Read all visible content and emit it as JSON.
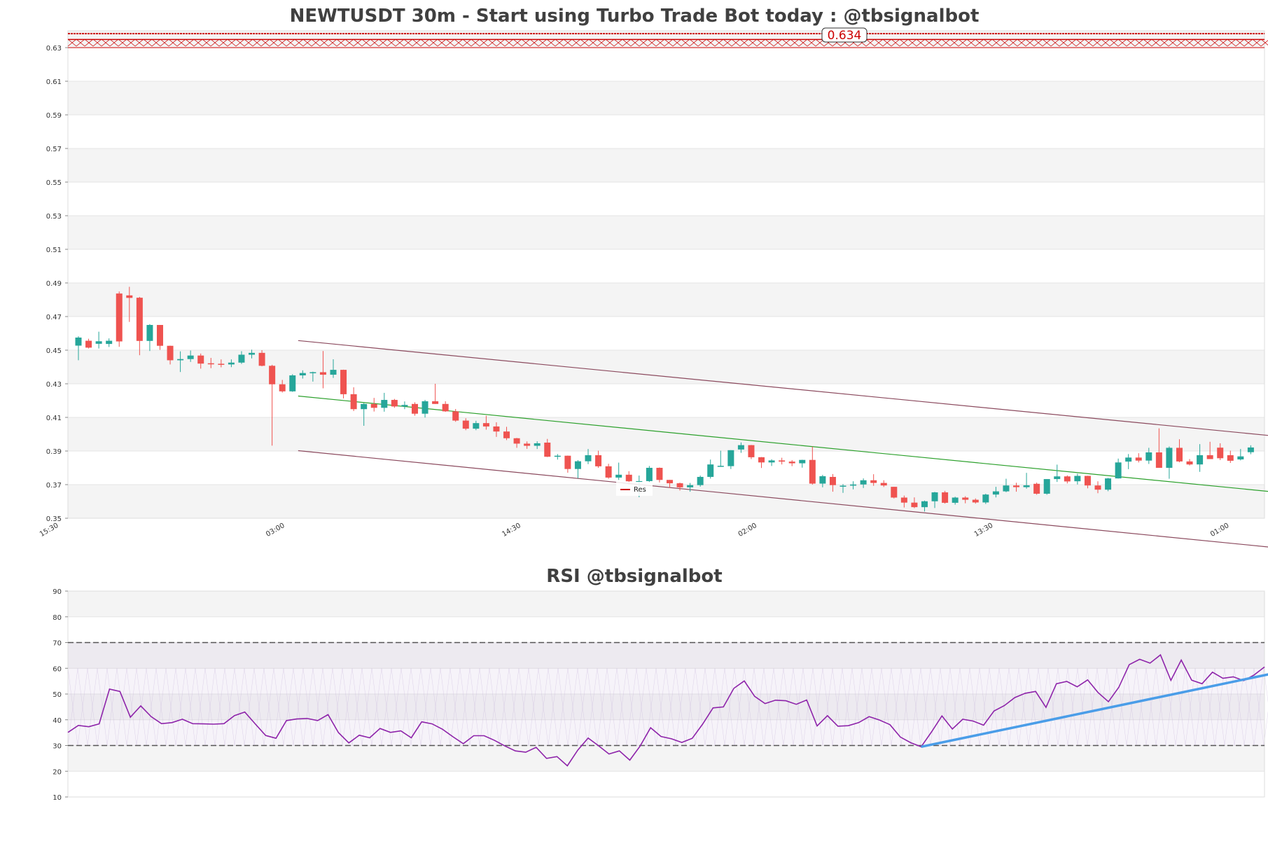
{
  "chart_data": [
    {
      "type": "candlestick",
      "title": "NEWTUSDT 30m - Start using Turbo Trade Bot today : @tbsignalbot",
      "ylim": [
        0.35,
        0.64
      ],
      "y_ticks": [
        "0.35",
        "0.37",
        "0.39",
        "0.41",
        "0.43",
        "0.45",
        "0.47",
        "0.49",
        "0.51",
        "0.53",
        "0.55",
        "0.57",
        "0.59",
        "0.61",
        "0.63"
      ],
      "x_ticks": [
        "15:30",
        "03:00",
        "14:30",
        "02:00",
        "13:30",
        "01:00"
      ],
      "grid": true,
      "colors": {
        "up": "#26a69a",
        "down": "#ef5350",
        "resistance": "#cc0000",
        "channel": "#8b4a5e",
        "midline": "#2ca02c"
      },
      "resistance": {
        "value": 0.634,
        "label": "0.634"
      },
      "legend": {
        "entries": [
          "Res"
        ],
        "placement": "bottom-center"
      },
      "candles": [
        [
          0.4527,
          0.4583,
          0.444,
          0.4575
        ],
        [
          0.4556,
          0.4568,
          0.451,
          0.4515
        ],
        [
          0.4538,
          0.461,
          0.451,
          0.4553
        ],
        [
          0.4537,
          0.457,
          0.4519,
          0.4556
        ],
        [
          0.4837,
          0.4849,
          0.452,
          0.4552
        ],
        [
          0.4826,
          0.4877,
          0.4668,
          0.4811
        ],
        [
          0.4812,
          0.4817,
          0.447,
          0.4555
        ],
        [
          0.4555,
          0.4655,
          0.4495,
          0.465
        ],
        [
          0.465,
          0.465,
          0.4502,
          0.4526
        ],
        [
          0.4526,
          0.4527,
          0.4415,
          0.444
        ],
        [
          0.444,
          0.4493,
          0.437,
          0.4447
        ],
        [
          0.4447,
          0.4498,
          0.443,
          0.4468
        ],
        [
          0.4468,
          0.448,
          0.439,
          0.442
        ],
        [
          0.4422,
          0.4454,
          0.4393,
          0.4419
        ],
        [
          0.4419,
          0.4445,
          0.4398,
          0.4415
        ],
        [
          0.4415,
          0.4445,
          0.4399,
          0.4426
        ],
        [
          0.4426,
          0.4494,
          0.4418,
          0.4473
        ],
        [
          0.4473,
          0.4503,
          0.4451,
          0.4484
        ],
        [
          0.4484,
          0.45,
          0.4404,
          0.4407
        ],
        [
          0.4407,
          0.4413,
          0.3932,
          0.4297
        ],
        [
          0.4297,
          0.4323,
          0.4248,
          0.4255
        ],
        [
          0.4255,
          0.4357,
          0.4252,
          0.435
        ],
        [
          0.435,
          0.438,
          0.4331,
          0.4364
        ],
        [
          0.4364,
          0.4372,
          0.4313,
          0.4369
        ],
        [
          0.4369,
          0.4495,
          0.4273,
          0.4354
        ],
        [
          0.4354,
          0.4446,
          0.4335,
          0.4383
        ],
        [
          0.4383,
          0.4384,
          0.4213,
          0.4238
        ],
        [
          0.4238,
          0.4279,
          0.4138,
          0.4149
        ],
        [
          0.4149,
          0.4185,
          0.405,
          0.418
        ],
        [
          0.418,
          0.4216,
          0.4135,
          0.4157
        ],
        [
          0.4157,
          0.4246,
          0.4134,
          0.4204
        ],
        [
          0.4204,
          0.421,
          0.4157,
          0.4165
        ],
        [
          0.4165,
          0.4195,
          0.4149,
          0.4174
        ],
        [
          0.418,
          0.419,
          0.411,
          0.4122
        ],
        [
          0.4122,
          0.4204,
          0.4099,
          0.4196
        ],
        [
          0.4196,
          0.43,
          0.418,
          0.418
        ],
        [
          0.418,
          0.4196,
          0.4133,
          0.4136
        ],
        [
          0.4136,
          0.415,
          0.4074,
          0.4081
        ],
        [
          0.4081,
          0.4095,
          0.4024,
          0.4033
        ],
        [
          0.4033,
          0.408,
          0.4024,
          0.4066
        ],
        [
          0.4066,
          0.411,
          0.4027,
          0.4046
        ],
        [
          0.4046,
          0.4071,
          0.3984,
          0.4016
        ],
        [
          0.4016,
          0.4044,
          0.3965,
          0.3976
        ],
        [
          0.3976,
          0.3978,
          0.3919,
          0.3944
        ],
        [
          0.3944,
          0.3957,
          0.3913,
          0.3931
        ],
        [
          0.3931,
          0.3958,
          0.3912,
          0.3946
        ],
        [
          0.395,
          0.3972,
          0.3864,
          0.3866
        ],
        [
          0.3866,
          0.3882,
          0.3849,
          0.3872
        ],
        [
          0.3872,
          0.3873,
          0.3771,
          0.3793
        ],
        [
          0.3793,
          0.3846,
          0.3738,
          0.3839
        ],
        [
          0.3839,
          0.3912,
          0.3822,
          0.3875
        ],
        [
          0.3875,
          0.3902,
          0.38,
          0.3809
        ],
        [
          0.3809,
          0.3824,
          0.3735,
          0.3742
        ],
        [
          0.3742,
          0.3831,
          0.3728,
          0.3759
        ],
        [
          0.3759,
          0.378,
          0.37,
          0.372
        ],
        [
          0.372,
          0.3754,
          0.3625,
          0.3721
        ],
        [
          0.3721,
          0.3811,
          0.3712,
          0.38
        ],
        [
          0.38,
          0.3802,
          0.3713,
          0.3728
        ],
        [
          0.3728,
          0.3728,
          0.3681,
          0.3708
        ],
        [
          0.3708,
          0.3712,
          0.3665,
          0.3684
        ],
        [
          0.3684,
          0.371,
          0.3658,
          0.3697
        ],
        [
          0.3697,
          0.3754,
          0.3688,
          0.3746
        ],
        [
          0.3746,
          0.3849,
          0.3736,
          0.382
        ],
        [
          0.381,
          0.3902,
          0.3806,
          0.3812
        ],
        [
          0.381,
          0.3905,
          0.3793,
          0.3905
        ],
        [
          0.3909,
          0.3951,
          0.3889,
          0.3935
        ],
        [
          0.3935,
          0.3936,
          0.3852,
          0.3863
        ],
        [
          0.3863,
          0.3864,
          0.3799,
          0.3832
        ],
        [
          0.3832,
          0.3851,
          0.3811,
          0.3844
        ],
        [
          0.3844,
          0.386,
          0.382,
          0.3837
        ],
        [
          0.3837,
          0.3846,
          0.381,
          0.3827
        ],
        [
          0.3827,
          0.3848,
          0.3801,
          0.3847
        ],
        [
          0.3847,
          0.3926,
          0.37,
          0.3706
        ],
        [
          0.3706,
          0.3758,
          0.3684,
          0.375
        ],
        [
          0.3746,
          0.3763,
          0.3658,
          0.3697
        ],
        [
          0.369,
          0.3703,
          0.3651,
          0.3694
        ],
        [
          0.3694,
          0.372,
          0.3672,
          0.3701
        ],
        [
          0.3701,
          0.3737,
          0.368,
          0.3726
        ],
        [
          0.3726,
          0.3762,
          0.3693,
          0.371
        ],
        [
          0.371,
          0.3726,
          0.3686,
          0.3695
        ],
        [
          0.3687,
          0.3687,
          0.3618,
          0.3623
        ],
        [
          0.3623,
          0.3635,
          0.3564,
          0.3593
        ],
        [
          0.3593,
          0.3624,
          0.356,
          0.3566
        ],
        [
          0.3566,
          0.3605,
          0.354,
          0.3601
        ],
        [
          0.3601,
          0.3657,
          0.3561,
          0.3654
        ],
        [
          0.3654,
          0.3663,
          0.3587,
          0.3592
        ],
        [
          0.3592,
          0.3628,
          0.3581,
          0.3623
        ],
        [
          0.3623,
          0.3631,
          0.3589,
          0.361
        ],
        [
          0.361,
          0.3618,
          0.3587,
          0.3594
        ],
        [
          0.3594,
          0.3646,
          0.3585,
          0.3641
        ],
        [
          0.3641,
          0.3687,
          0.3624,
          0.366
        ],
        [
          0.366,
          0.3735,
          0.3655,
          0.3695
        ],
        [
          0.3695,
          0.3711,
          0.3658,
          0.3685
        ],
        [
          0.3685,
          0.377,
          0.3676,
          0.3696
        ],
        [
          0.3705,
          0.3712,
          0.364,
          0.3646
        ],
        [
          0.3646,
          0.3732,
          0.364,
          0.3733
        ],
        [
          0.3733,
          0.3819,
          0.3716,
          0.3749
        ],
        [
          0.3749,
          0.3755,
          0.3707,
          0.3719
        ],
        [
          0.372,
          0.3765,
          0.3701,
          0.3752
        ],
        [
          0.3752,
          0.3753,
          0.3678,
          0.3695
        ],
        [
          0.3695,
          0.372,
          0.3649,
          0.367
        ],
        [
          0.367,
          0.374,
          0.3661,
          0.3737
        ],
        [
          0.3737,
          0.3855,
          0.3736,
          0.3832
        ],
        [
          0.3837,
          0.3882,
          0.3792,
          0.3861
        ],
        [
          0.3861,
          0.3887,
          0.3832,
          0.3843
        ],
        [
          0.3843,
          0.3919,
          0.3823,
          0.3892
        ],
        [
          0.3892,
          0.4035,
          0.3804,
          0.38
        ],
        [
          0.38,
          0.3927,
          0.3735,
          0.3919
        ],
        [
          0.3919,
          0.397,
          0.3833,
          0.3838
        ],
        [
          0.3838,
          0.3852,
          0.3814,
          0.382
        ],
        [
          0.382,
          0.3941,
          0.3776,
          0.3875
        ],
        [
          0.3875,
          0.3955,
          0.3852,
          0.3852
        ],
        [
          0.392,
          0.3946,
          0.3846,
          0.3857
        ],
        [
          0.3875,
          0.3902,
          0.3829,
          0.3842
        ],
        [
          0.385,
          0.3912,
          0.3844,
          0.3868
        ],
        [
          0.3893,
          0.3934,
          0.3881,
          0.3921
        ]
      ],
      "channel_lines": [
        {
          "name": "upper",
          "from": {
            "i": 14,
            "v": 0.4557
          },
          "to": {
            "i": 113,
            "v": 0.397
          }
        },
        {
          "name": "middle",
          "from": {
            "i": 14,
            "v": 0.4227
          },
          "to": {
            "i": 113,
            "v": 0.3637
          }
        },
        {
          "name": "lower",
          "from": {
            "i": 14,
            "v": 0.3902
          },
          "to": {
            "i": 113,
            "v": 0.3306
          }
        }
      ]
    },
    {
      "type": "line",
      "title": "RSI @tbsignalbot",
      "ylim": [
        10,
        90
      ],
      "y_ticks": [
        "10",
        "20",
        "30",
        "40",
        "50",
        "60",
        "70",
        "80",
        "90"
      ],
      "levels": [
        30,
        70
      ],
      "grid": true,
      "colors": {
        "rsi": "#8e24aa",
        "trend": "#4a9de8",
        "level": "#555555",
        "band": "#ccbbdd"
      },
      "series": [
        {
          "values": [
            35.1,
            37.8,
            37.3,
            38.4,
            51.9,
            51.0,
            41.0,
            45.4,
            41.2,
            38.5,
            38.9,
            40.2,
            38.5,
            38.4,
            38.3,
            38.5,
            41.6,
            43.0,
            38.4,
            33.9,
            32.8,
            39.7,
            40.3,
            40.5,
            39.7,
            42.0,
            35.0,
            31.0,
            34.0,
            33.0,
            36.6,
            35.1,
            35.7,
            33.0,
            39.2,
            38.4,
            36.3,
            33.4,
            30.7,
            33.8,
            33.8,
            32.0,
            29.8,
            27.9,
            27.4,
            29.3,
            25.0,
            25.7,
            22.1,
            28.2,
            32.9,
            29.9,
            26.7,
            27.9,
            24.3,
            29.8,
            36.9,
            33.5,
            32.6,
            31.2,
            32.8,
            38.3,
            44.6,
            45.0,
            52.2,
            55.1,
            49.1,
            46.3,
            47.6,
            47.4,
            46.0,
            47.7,
            37.6,
            41.6,
            37.5,
            37.7,
            38.9,
            41.2,
            39.9,
            38.1,
            33.3,
            31.1,
            29.5,
            35.3,
            41.5,
            36.4,
            40.2,
            39.5,
            37.9,
            43.4,
            45.5,
            48.6,
            50.3,
            51.0,
            44.8,
            54.0,
            54.9,
            52.8,
            55.5,
            50.6,
            47.0,
            52.6,
            61.4,
            63.5,
            62.0,
            65.2,
            55.3,
            63.2,
            55.4,
            54.0,
            58.5,
            56.1,
            56.7,
            55.2,
            57.4,
            60.5
          ]
        },
        {
          "values": [
            29.5,
            59.0
          ],
          "x_index": [
            82,
            117
          ]
        }
      ]
    }
  ]
}
